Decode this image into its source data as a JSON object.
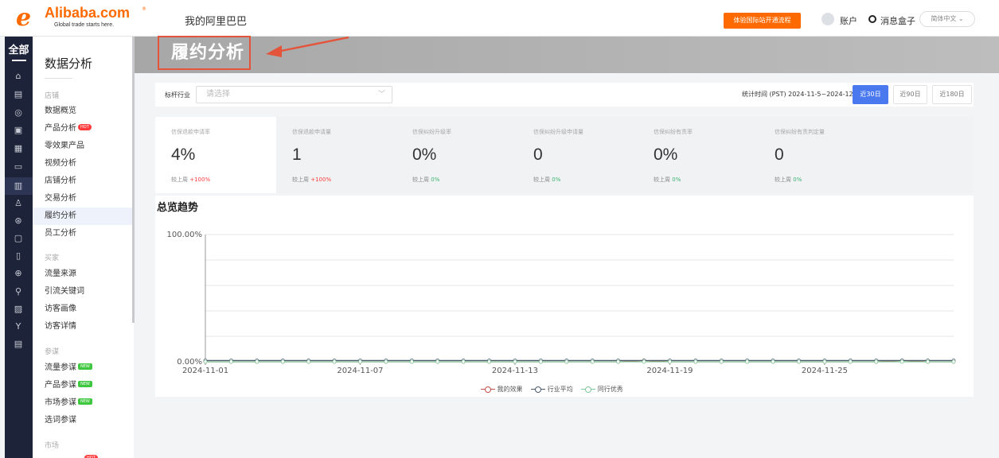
{
  "header": {
    "logo_text": "Alibaba.com",
    "logo_tagline": "Global trade starts here.",
    "logo_badge": "®",
    "my_alibaba": "我的阿里巴巴",
    "cta": "体验国际站开通流程",
    "account": "账户",
    "message_box": "消息盒子",
    "language": "简体中文"
  },
  "rail": {
    "all_label": "全部"
  },
  "menu": {
    "title": "数据分析",
    "groups": [
      {
        "label": "店铺",
        "items": [
          "数据概览",
          "产品分析",
          "零效果产品",
          "视频分析",
          "店铺分析",
          "交易分析",
          "履约分析",
          "员工分析"
        ]
      },
      {
        "label": "买家",
        "items": [
          "流量来源",
          "引流关键词",
          "访客画像",
          "访客详情"
        ]
      },
      {
        "label": "参谋",
        "items": [
          "流量参谋",
          "产品参谋",
          "市场参谋",
          "选词参谋"
        ]
      },
      {
        "label": "市场",
        "items": []
      }
    ],
    "hot_tag": "HOT",
    "new_tag": "NEW"
  },
  "page": {
    "title": "履约分析"
  },
  "filter": {
    "label": "标杆行业",
    "placeholder": "请选择",
    "stat_time": "统计时间 (PST) 2024-11-5~2024-12-5",
    "ranges": [
      "近30日",
      "近90日",
      "近180日"
    ],
    "active_range": "近30日"
  },
  "kpis": [
    {
      "title": "信保退款申请率",
      "value": "4%",
      "cmp_label": "较上周",
      "cmp_value": "+100%",
      "trend": "up"
    },
    {
      "title": "信保退款申请量",
      "value": "1",
      "cmp_label": "较上周",
      "cmp_value": "+100%",
      "trend": "up"
    },
    {
      "title": "信保纠纷升级率",
      "value": "0%",
      "cmp_label": "较上周",
      "cmp_value": "0%",
      "trend": "flat"
    },
    {
      "title": "信保纠纷升级申请量",
      "value": "0",
      "cmp_label": "较上周",
      "cmp_value": "0%",
      "trend": "flat"
    },
    {
      "title": "信保纠纷有责率",
      "value": "0%",
      "cmp_label": "较上周",
      "cmp_value": "0%",
      "trend": "flat"
    },
    {
      "title": "信保纠纷有责判定量",
      "value": "0",
      "cmp_label": "较上周",
      "cmp_value": "0%",
      "trend": "flat"
    }
  ],
  "chart": {
    "heading": "总览趋势"
  },
  "chart_data": {
    "type": "line",
    "title": "总览趋势",
    "y_ticks": [
      "0.00%",
      "100.00%"
    ],
    "ylim": [
      0,
      100
    ],
    "x_ticks": [
      "2024-11-01",
      "2024-11-07",
      "2024-11-13",
      "2024-11-19",
      "2024-11-25"
    ],
    "x": [
      "2024-11-01",
      "2024-11-02",
      "2024-11-03",
      "2024-11-04",
      "2024-11-05",
      "2024-11-06",
      "2024-11-07",
      "2024-11-08",
      "2024-11-09",
      "2024-11-10",
      "2024-11-11",
      "2024-11-12",
      "2024-11-13",
      "2024-11-14",
      "2024-11-15",
      "2024-11-16",
      "2024-11-17",
      "2024-11-18",
      "2024-11-19",
      "2024-11-20",
      "2024-11-21",
      "2024-11-22",
      "2024-11-23",
      "2024-11-24",
      "2024-11-25",
      "2024-11-26",
      "2024-11-27",
      "2024-11-28",
      "2024-11-29",
      "2024-11-30"
    ],
    "series": [
      {
        "name": "我的效果",
        "color": "#c0504d",
        "values": [
          0,
          0,
          0,
          0,
          0,
          0,
          0,
          0,
          0,
          0,
          0,
          0,
          0,
          0,
          0,
          0,
          0,
          1,
          0,
          0,
          0,
          0,
          0,
          0,
          0,
          0,
          0,
          1,
          0,
          0
        ]
      },
      {
        "name": "行业平均",
        "color": "#4a5a6b",
        "values": [
          1,
          1,
          1,
          1,
          1,
          1,
          1,
          1,
          1,
          1,
          1,
          1,
          1,
          1,
          1,
          1,
          1,
          1,
          1,
          1,
          1,
          1,
          1,
          1,
          1,
          1,
          1,
          1,
          1,
          1
        ]
      },
      {
        "name": "同行优秀",
        "color": "#7fc99b",
        "values": [
          0,
          0,
          0,
          0,
          0,
          0,
          0,
          0,
          0,
          0,
          0,
          0,
          0,
          0,
          0,
          0,
          0,
          0,
          0,
          0,
          0,
          0,
          0,
          0,
          0,
          0,
          0,
          0,
          0,
          0
        ]
      }
    ]
  }
}
